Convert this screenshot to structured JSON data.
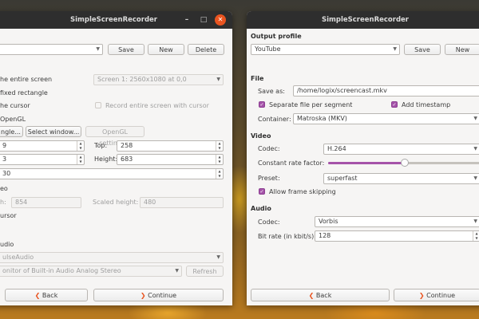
{
  "left_window": {
    "title": "SimpleScreenRecorder",
    "profile": {
      "save": "Save",
      "new": "New",
      "delete": "Delete"
    },
    "record_entire_screen": "he entire screen",
    "screen_select": "Screen 1: 2560x1080 at 0,0",
    "fixed_rectangle": "fixed rectangle",
    "follow_cursor": "he cursor",
    "record_entire_screen_with_cursor": "Record entire screen with cursor",
    "opengl": "OpenGL",
    "select_rectangle": "ngle...",
    "select_window": "Select window...",
    "opengl_settings": "OpenGL settings...",
    "left_value": "9",
    "top_label": "Top:",
    "top_value": "258",
    "width_value": "3",
    "height_label": "Height:",
    "height_value": "683",
    "frame_rate_value": "30",
    "scale_video": "eo",
    "scaled_width_suffix": "h:",
    "scaled_width_value": "854",
    "scaled_height_label": "Scaled height:",
    "scaled_height_value": "480",
    "record_cursor": "ursor",
    "audio": "udio",
    "audio_backend": "ulseAudio",
    "audio_source": "onitor of Built-in Audio Analog Stereo",
    "refresh": "Refresh",
    "back": "Back",
    "continue": "Continue"
  },
  "right_window": {
    "title": "SimpleScreenRecorder",
    "output_profile_label": "Output profile",
    "output_profile_value": "YouTube",
    "save": "Save",
    "new": "New",
    "file_label": "File",
    "save_as_label": "Save as:",
    "save_as_value": "/home/logix/screencast.mkv",
    "separate_file": "Separate file per segment",
    "add_timestamp": "Add timestamp",
    "container_label": "Container:",
    "container_value": "Matroska (MKV)",
    "video_label": "Video",
    "video_codec_label": "Codec:",
    "video_codec_value": "H.264",
    "crf_label": "Constant rate factor:",
    "crf_fraction": 0.5,
    "preset_label": "Preset:",
    "preset_value": "superfast",
    "allow_frame_skipping": "Allow frame skipping",
    "audio_label": "Audio",
    "audio_codec_label": "Codec:",
    "audio_codec_value": "Vorbis",
    "bitrate_label": "Bit rate (in kbit/s):",
    "bitrate_value": "128",
    "back": "Back",
    "continue": "Continue"
  },
  "colors": {
    "accent": "#a553a9",
    "close": "#e95420",
    "titlebar": "#2e2e2e",
    "arrow": "#e95420"
  }
}
